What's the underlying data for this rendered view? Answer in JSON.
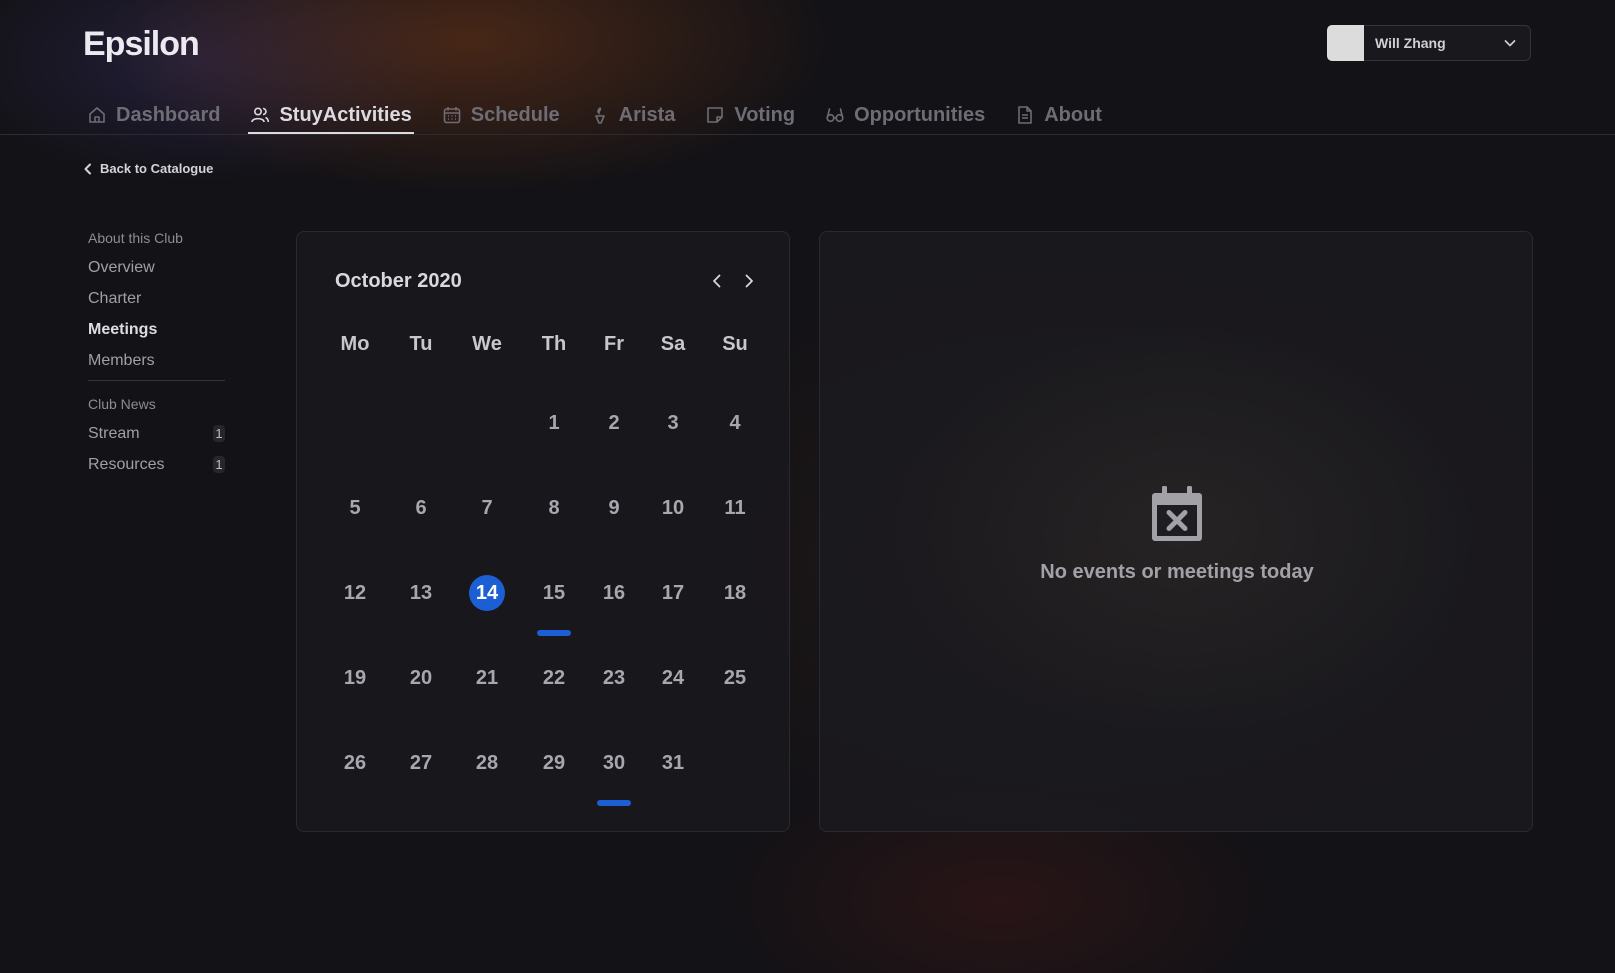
{
  "app": {
    "logo": "Epsilon"
  },
  "user": {
    "name": "Will Zhang"
  },
  "nav": {
    "tabs": [
      {
        "label": "Dashboard",
        "icon": "home-icon",
        "active": false
      },
      {
        "label": "StuyActivities",
        "icon": "users-icon",
        "active": true
      },
      {
        "label": "Schedule",
        "icon": "calendar-icon",
        "active": false
      },
      {
        "label": "Arista",
        "icon": "torch-icon",
        "active": false
      },
      {
        "label": "Voting",
        "icon": "note-icon",
        "active": false
      },
      {
        "label": "Opportunities",
        "icon": "glasses-icon",
        "active": false
      },
      {
        "label": "About",
        "icon": "document-icon",
        "active": false
      }
    ]
  },
  "back_link": {
    "label": "Back to Catalogue"
  },
  "sidebar": {
    "about_heading": "About this Club",
    "about_items": [
      {
        "label": "Overview",
        "active": false
      },
      {
        "label": "Charter",
        "active": false
      },
      {
        "label": "Meetings",
        "active": true
      },
      {
        "label": "Members",
        "active": false
      }
    ],
    "news_heading": "Club News",
    "news_items": [
      {
        "label": "Stream",
        "badge": "1"
      },
      {
        "label": "Resources",
        "badge": "1"
      }
    ]
  },
  "calendar": {
    "month_label": "October 2020",
    "weekdays": [
      "Mo",
      "Tu",
      "We",
      "Th",
      "Fr",
      "Sa",
      "Su"
    ],
    "first_weekday_index": 3,
    "days_in_month": 31,
    "selected_day": 14,
    "event_days": [
      15,
      30
    ],
    "accent_color": "#1c5fd4"
  },
  "events_panel": {
    "empty_icon": "calendar-x-icon",
    "empty_message": "No events or meetings today"
  }
}
